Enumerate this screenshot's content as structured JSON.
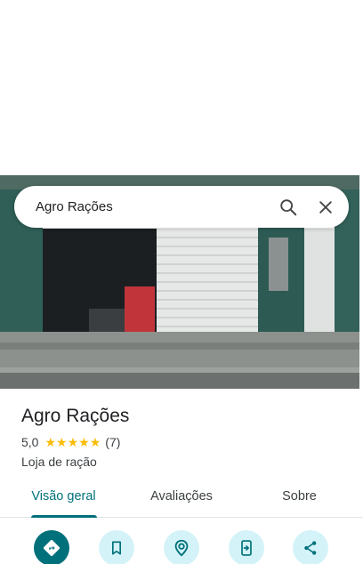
{
  "search": {
    "query": "Agro Rações"
  },
  "place": {
    "name": "Agro Rações",
    "rating": "5,0",
    "stars": 5,
    "review_count": "(7)",
    "category": "Loja de ração"
  },
  "tabs": [
    {
      "label": "Visão geral",
      "active": true
    },
    {
      "label": "Avaliações",
      "active": false
    },
    {
      "label": "Sobre",
      "active": false
    }
  ],
  "actions": [
    {
      "icon": "directions-icon",
      "primary": true
    },
    {
      "icon": "bookmark-icon",
      "primary": false
    },
    {
      "icon": "nearby-icon",
      "primary": false
    },
    {
      "icon": "send-to-phone-icon",
      "primary": false
    },
    {
      "icon": "share-icon",
      "primary": false
    }
  ],
  "colors": {
    "accent": "#00707a",
    "accent_light": "#d3f3f8",
    "star": "#fbbc04",
    "text_primary": "#202124",
    "text_secondary": "#3c4043"
  }
}
